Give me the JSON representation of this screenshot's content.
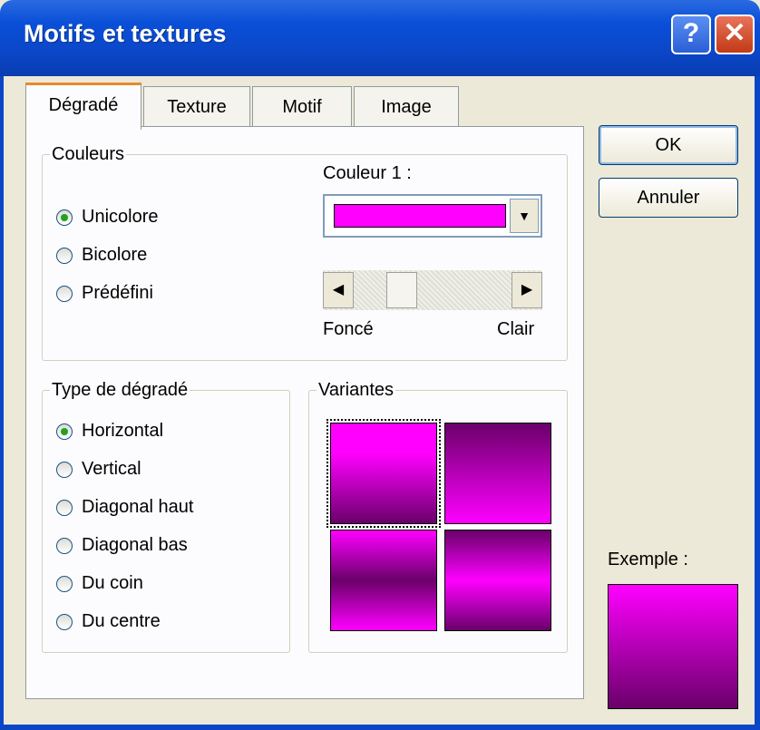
{
  "window": {
    "title": "Motifs et textures",
    "help_glyph": "?",
    "close_glyph": "✕"
  },
  "tabs": [
    "Dégradé",
    "Texture",
    "Motif",
    "Image"
  ],
  "couleurs": {
    "legend": "Couleurs",
    "options": [
      "Unicolore",
      "Bicolore",
      "Prédéfini"
    ],
    "selected": 0,
    "couleur1_label": "Couleur 1 :",
    "couleur1_value": "#ff00ff",
    "slider_left": "Foncé",
    "slider_right": "Clair",
    "slider_level": 0.2
  },
  "type_degrade": {
    "legend": "Type de dégradé",
    "options": [
      "Horizontal",
      "Vertical",
      "Diagonal haut",
      "Diagonal bas",
      "Du coin",
      "Du centre"
    ],
    "selected": 0
  },
  "variantes": {
    "legend": "Variantes"
  },
  "buttons": {
    "ok": "OK",
    "cancel": "Annuler"
  },
  "exemple_label": "Exemple :",
  "colors": {
    "accent": "#ff00ff",
    "dark": "#6a006a",
    "title_bar": "#0a4fd8"
  }
}
